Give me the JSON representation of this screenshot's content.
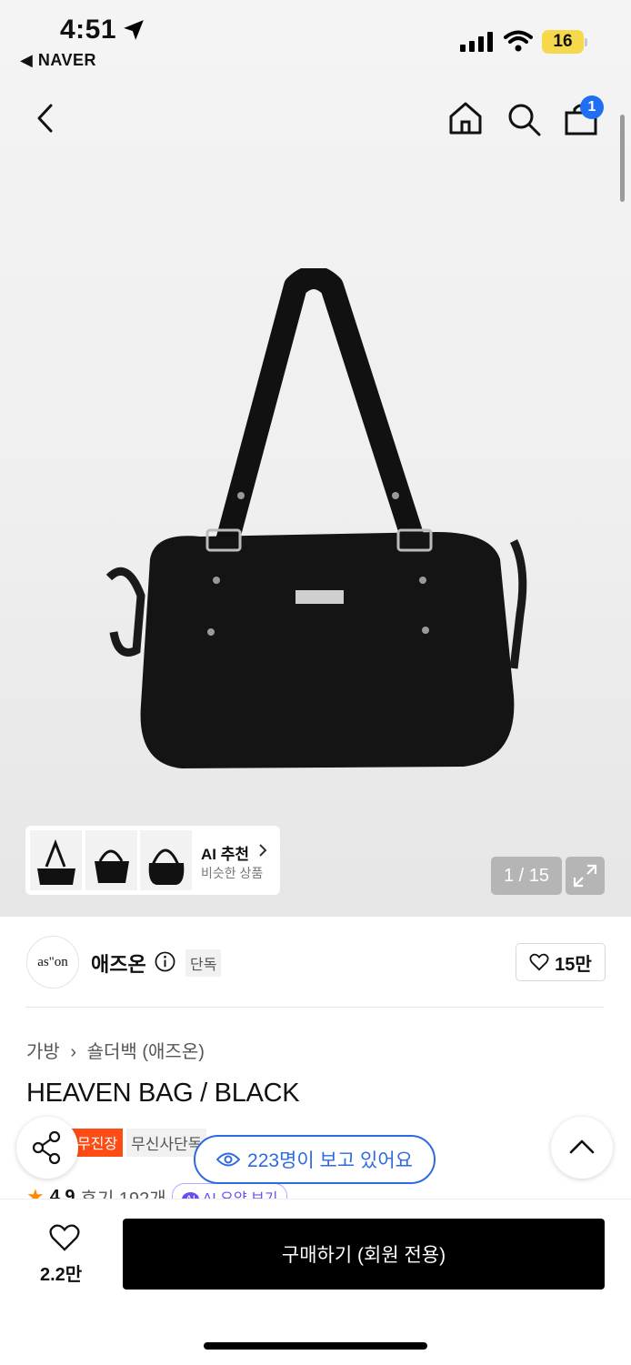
{
  "status_bar": {
    "time": "4:51",
    "back_app": "◀ NAVER",
    "battery": "16"
  },
  "header": {
    "cart_badge": "1"
  },
  "gallery": {
    "ai_title": "AI 추천",
    "ai_subtitle": "비슷한 상품",
    "counter": "1 / 15"
  },
  "brand": {
    "logo_text": "as\"on",
    "name": "애즈온",
    "exclusive_tag": "단독",
    "likes": "15만"
  },
  "product": {
    "breadcrumb": [
      "가방",
      "숄더백 (애즈온)"
    ],
    "title": "HEAVEN BAG / BLACK",
    "tags": [
      "무진장",
      "무신사단독"
    ],
    "rating": "4.9",
    "reviews": "후기 192개",
    "ai_summary": "AI 요약 보기"
  },
  "viewers": "223명이 보고 있어요",
  "footer": {
    "wish_count": "2.2만",
    "buy_label": "구매하기 (회원 전용)"
  },
  "colors": {
    "accent_blue": "#2e6ae0",
    "badge_blue": "#1f6ff2",
    "tag_red": "#ff4b14",
    "battery": "#f5d94a"
  }
}
